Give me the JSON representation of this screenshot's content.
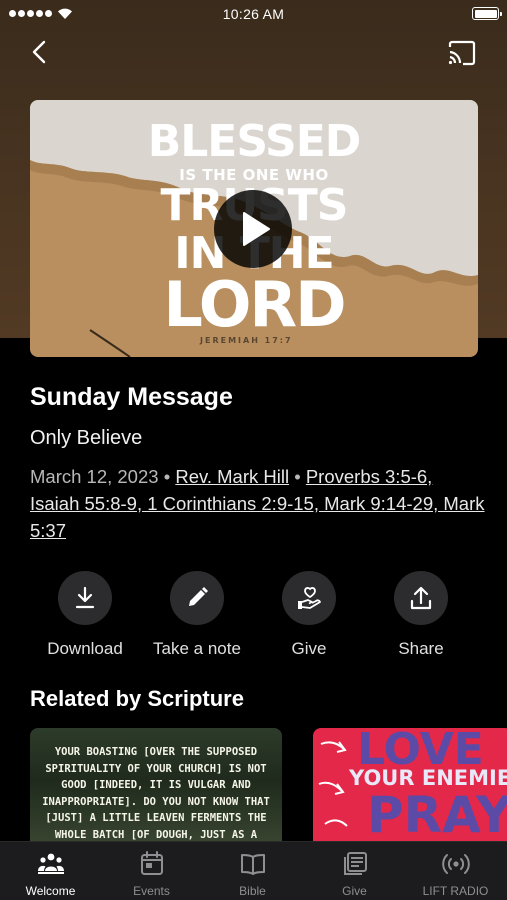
{
  "status_bar": {
    "time": "10:26 AM"
  },
  "media": {
    "art_line1": "BLESSED",
    "art_line2": "IS THE ONE WHO",
    "art_line3": "TRUSTS",
    "art_line4": "IN THE",
    "art_line5": "LORD",
    "art_reference": "JEREMIAH 17:7"
  },
  "message": {
    "title": "Sunday Message",
    "subtitle": "Only Believe",
    "date": "March 12, 2023",
    "separator": "•",
    "speaker": "Rev. Mark Hill",
    "scriptures": "Proverbs 3:5-6, Isaiah 55:8-9, 1 Corinthians 2:9-15, Mark 9:14-29, Mark 5:37"
  },
  "actions": [
    {
      "label": "Download",
      "icon": "download-icon"
    },
    {
      "label": "Take a note",
      "icon": "pencil-icon"
    },
    {
      "label": "Give",
      "icon": "give-icon"
    },
    {
      "label": "Share",
      "icon": "share-icon"
    }
  ],
  "related": {
    "title": "Related by Scripture",
    "card1_text": "YOUR BOASTING [OVER THE SUPPOSED SPIRITUALITY OF YOUR CHURCH] IS NOT GOOD [INDEED, IT IS VULGAR AND INAPPROPRIATE]. DO YOU NOT KNOW THAT [JUST] A LITTLE LEAVEN FERMENTS THE WHOLE BATCH [OF DOUGH, JUST AS A",
    "card2_line1": "LOVE",
    "card2_line2": "YOUR ENEMIES",
    "card2_line3": "PRAY"
  },
  "tabs": [
    {
      "label": "Welcome",
      "icon": "people-icon",
      "active": true
    },
    {
      "label": "Events",
      "icon": "calendar-icon",
      "active": false
    },
    {
      "label": "Bible",
      "icon": "book-icon",
      "active": false
    },
    {
      "label": "Give",
      "icon": "gift-card-icon",
      "active": false
    },
    {
      "label": "LIFT RADIO",
      "icon": "radio-icon",
      "active": false
    }
  ],
  "colors": {
    "background": "#000000",
    "hero_brown": "#4a3521",
    "action_circle": "#2c2c2e",
    "tabbar": "#1c1c1e",
    "muted_text": "#b8b8b8",
    "inactive_tab": "#8e8e93"
  }
}
